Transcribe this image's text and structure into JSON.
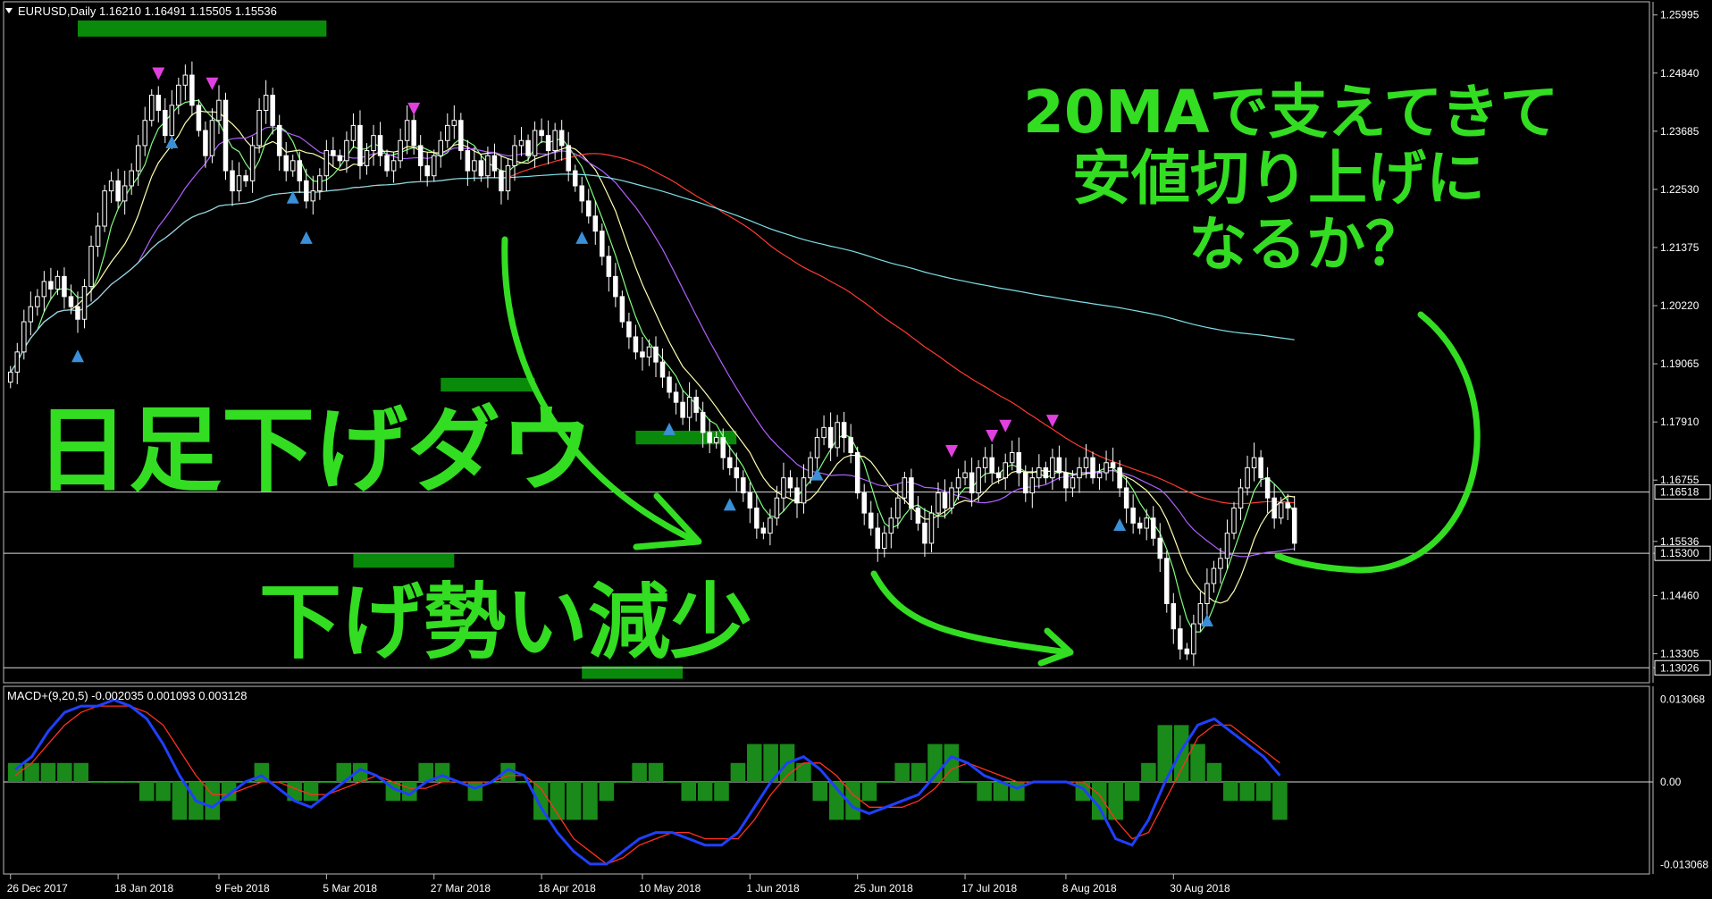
{
  "window": {
    "symbol_line": "EURUSD,Daily  1.16210 1.16491 1.15505 1.15536",
    "menu_icon": "triangle-down-icon"
  },
  "colors": {
    "background": "#000000",
    "bull_candle": "#ffffff",
    "bear_candle": "#ffffff",
    "ma_fast": "#7fff7f",
    "ma_yellow": "#ffffb0",
    "ma_purple": "#b060ff",
    "ma_red": "#ff3b30",
    "ma_cyan": "#7fe0e8",
    "zone": "#0a8a0a",
    "annotation": "#33dd22",
    "arrow_up": "#3a8fd8",
    "arrow_down": "#e040e0",
    "macd_line": "#2040ff",
    "signal_line": "#ff3020",
    "histogram": "#1a8a1a"
  },
  "chart_data": [
    {
      "type": "candlestick",
      "title": "EURUSD,Daily",
      "ohlc_header": {
        "open": 1.1621,
        "high": 1.16491,
        "low": 1.15505,
        "close": 1.15536
      },
      "x_ticks": [
        "26 Dec 2017",
        "18 Jan 2018",
        "9 Feb 2018",
        "5 Mar 2018",
        "27 Mar 2018",
        "18 Apr 2018",
        "10 May 2018",
        "1 Jun 2018",
        "25 Jun 2018",
        "17 Jul 2018",
        "8 Aug 2018",
        "30 Aug 2018"
      ],
      "y_ticks": [
        "1.25995",
        "1.24840",
        "1.23685",
        "1.22530",
        "1.21375",
        "1.20220",
        "1.19065",
        "1.17910",
        "1.16755",
        "1.15536",
        "1.15300",
        "1.14460",
        "1.13305",
        "1.13026"
      ],
      "ylim": [
        1.128,
        1.2615
      ],
      "price_labels": [
        {
          "value": 1.16518,
          "text": "1.16518",
          "boxed": true
        },
        {
          "value": 1.15536,
          "text": "1.15536",
          "boxed": false
        },
        {
          "value": 1.153,
          "text": "1.15300",
          "boxed": true
        },
        {
          "value": 1.13026,
          "text": "1.13026",
          "boxed": true
        }
      ],
      "horizontal_lines": [
        1.16518,
        1.153,
        1.13026
      ],
      "close_series": [
        1.189,
        1.193,
        1.199,
        1.202,
        1.204,
        1.207,
        1.2055,
        1.208,
        1.204,
        1.202,
        1.1995,
        1.206,
        1.214,
        1.218,
        1.225,
        1.227,
        1.223,
        1.226,
        1.229,
        1.234,
        1.239,
        1.244,
        1.241,
        1.236,
        1.242,
        1.246,
        1.248,
        1.242,
        1.237,
        1.232,
        1.239,
        1.243,
        1.229,
        1.225,
        1.228,
        1.227,
        1.234,
        1.241,
        1.244,
        1.238,
        1.232,
        1.229,
        1.231,
        1.227,
        1.223,
        1.225,
        1.228,
        1.233,
        1.232,
        1.231,
        1.235,
        1.238,
        1.23,
        1.233,
        1.236,
        1.232,
        1.229,
        1.231,
        1.235,
        1.239,
        1.234,
        1.23,
        1.228,
        1.232,
        1.235,
        1.238,
        1.239,
        1.233,
        1.229,
        1.231,
        1.228,
        1.232,
        1.229,
        1.225,
        1.23,
        1.234,
        1.235,
        1.232,
        1.237,
        1.236,
        1.233,
        1.237,
        1.234,
        1.229,
        1.226,
        1.223,
        1.22,
        1.217,
        1.212,
        1.208,
        1.204,
        1.199,
        1.196,
        1.193,
        1.192,
        1.194,
        1.191,
        1.188,
        1.185,
        1.183,
        1.18,
        1.184,
        1.181,
        1.177,
        1.175,
        1.176,
        1.172,
        1.17,
        1.168,
        1.165,
        1.162,
        1.158,
        1.157,
        1.16,
        1.164,
        1.168,
        1.166,
        1.163,
        1.168,
        1.172,
        1.176,
        1.178,
        1.174,
        1.179,
        1.176,
        1.173,
        1.165,
        1.161,
        1.158,
        1.154,
        1.157,
        1.16,
        1.164,
        1.168,
        1.162,
        1.159,
        1.155,
        1.161,
        1.165,
        1.162,
        1.166,
        1.168,
        1.169,
        1.165,
        1.17,
        1.172,
        1.169,
        1.168,
        1.171,
        1.173,
        1.169,
        1.165,
        1.168,
        1.17,
        1.168,
        1.172,
        1.169,
        1.166,
        1.168,
        1.17,
        1.172,
        1.168,
        1.169,
        1.171,
        1.17,
        1.166,
        1.162,
        1.159,
        1.158,
        1.16,
        1.156,
        1.152,
        1.143,
        1.138,
        1.134,
        1.133,
        1.139,
        1.143,
        1.147,
        1.15,
        1.152,
        1.157,
        1.162,
        1.166,
        1.17,
        1.172,
        1.168,
        1.164,
        1.16,
        1.163,
        1.162,
        1.155
      ],
      "moving_averages": [
        {
          "color": "ma_fast",
          "period": 5
        },
        {
          "color": "ma_yellow",
          "period": 10
        },
        {
          "color": "ma_purple",
          "period": 20
        },
        {
          "color": "ma_red",
          "period": 75
        },
        {
          "color": "ma_cyan",
          "period": 200
        }
      ],
      "resistance_zones": [
        {
          "from": 1.2585,
          "to": 1.256,
          "x_start": 10,
          "x_end": 47
        },
        {
          "from": 1.1875,
          "to": 1.1855,
          "x_start": 64,
          "x_end": 78
        },
        {
          "from": 1.177,
          "to": 1.175,
          "x_start": 93,
          "x_end": 108
        }
      ],
      "support_zones": [
        {
          "from": 1.1525,
          "to": 1.1505,
          "x_start": 51,
          "x_end": 66
        },
        {
          "from": 1.1302,
          "to": 1.1285,
          "x_start": 85,
          "x_end": 100
        }
      ],
      "annotations": [
        {
          "text": "日足下げダウ"
        },
        {
          "text": "下げ勢い減少"
        },
        {
          "text": "20MAで支えてきて"
        },
        {
          "text": "安値切り上げに"
        },
        {
          "text": "なるか？"
        }
      ]
    },
    {
      "type": "macd",
      "label": "MACD+(9,20,5) -0.002035 0.001093 0.003128",
      "y_ticks": [
        "0.013068",
        "0.00",
        "-0.013068"
      ],
      "ylim": [
        -0.014,
        0.014
      ],
      "macd_series": [
        0.002,
        0.004,
        0.008,
        0.011,
        0.012,
        0.012,
        0.013,
        0.012,
        0.01,
        0.006,
        0.001,
        -0.003,
        -0.004,
        -0.002,
        0.0,
        0.001,
        -0.001,
        -0.003,
        -0.004,
        -0.002,
        0.0,
        0.002,
        0.001,
        -0.001,
        -0.002,
        0.0,
        0.001,
        0.0,
        -0.001,
        0.0,
        0.002,
        0.001,
        -0.004,
        -0.008,
        -0.011,
        -0.013,
        -0.013,
        -0.011,
        -0.009,
        -0.008,
        -0.008,
        -0.009,
        -0.01,
        -0.01,
        -0.008,
        -0.004,
        0.0,
        0.003,
        0.004,
        0.002,
        -0.001,
        -0.004,
        -0.005,
        -0.004,
        -0.003,
        -0.002,
        0.001,
        0.004,
        0.003,
        0.001,
        0.0,
        -0.001,
        0.0,
        0.0,
        0.0,
        -0.001,
        -0.004,
        -0.009,
        -0.01,
        -0.006,
        0.0,
        0.005,
        0.009,
        0.01,
        0.008,
        0.006,
        0.004,
        0.001
      ],
      "signal_series": [
        0.001,
        0.003,
        0.006,
        0.009,
        0.011,
        0.012,
        0.012,
        0.012,
        0.011,
        0.009,
        0.005,
        0.001,
        -0.002,
        -0.002,
        -0.001,
        0.0,
        0.0,
        -0.001,
        -0.002,
        -0.002,
        -0.001,
        0.0,
        0.001,
        0.0,
        -0.001,
        -0.001,
        0.0,
        0.0,
        0.0,
        0.0,
        0.001,
        0.001,
        -0.001,
        -0.005,
        -0.009,
        -0.011,
        -0.013,
        -0.012,
        -0.01,
        -0.009,
        -0.008,
        -0.008,
        -0.009,
        -0.009,
        -0.009,
        -0.006,
        -0.002,
        0.001,
        0.003,
        0.003,
        0.001,
        -0.002,
        -0.004,
        -0.004,
        -0.004,
        -0.003,
        -0.001,
        0.002,
        0.003,
        0.002,
        0.001,
        0.0,
        0.0,
        0.0,
        0.0,
        0.0,
        -0.002,
        -0.006,
        -0.009,
        -0.008,
        -0.003,
        0.002,
        0.007,
        0.009,
        0.009,
        0.007,
        0.005,
        0.003
      ],
      "hist_series": [
        0.001,
        0.001,
        0.001,
        0.001,
        0.001,
        0.0,
        0.0,
        0.0,
        -0.001,
        -0.001,
        -0.002,
        -0.002,
        -0.002,
        -0.001,
        0.0,
        0.001,
        0.0,
        -0.001,
        -0.001,
        0.0,
        0.001,
        0.001,
        0.0,
        -0.001,
        -0.001,
        0.001,
        0.001,
        0.0,
        -0.001,
        0.0,
        0.001,
        0.0,
        -0.002,
        -0.002,
        -0.002,
        -0.002,
        -0.001,
        0.0,
        0.001,
        0.001,
        0.0,
        -0.001,
        -0.001,
        -0.001,
        0.001,
        0.002,
        0.002,
        0.002,
        0.001,
        -0.001,
        -0.002,
        -0.002,
        -0.001,
        0.0,
        0.001,
        0.001,
        0.002,
        0.002,
        0.0,
        -0.001,
        -0.001,
        -0.001,
        0.0,
        0.0,
        0.0,
        -0.001,
        -0.002,
        -0.002,
        -0.001,
        0.001,
        0.003,
        0.003,
        0.002,
        0.001,
        -0.001,
        -0.001,
        -0.001,
        -0.002
      ]
    }
  ]
}
